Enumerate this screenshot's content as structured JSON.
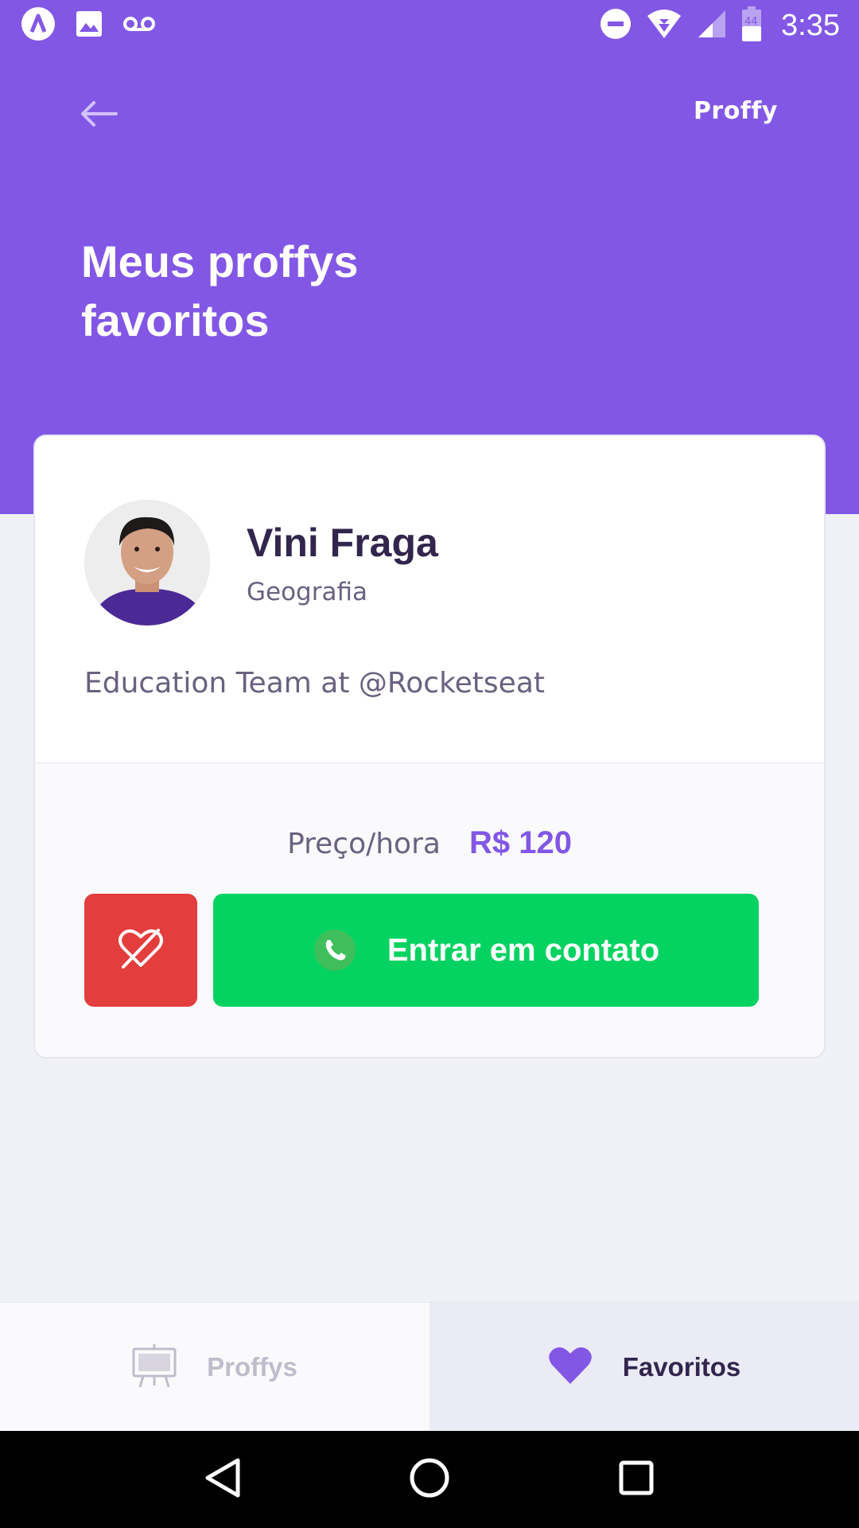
{
  "status_bar": {
    "time": "3:35",
    "battery_level": "44",
    "left_icons": [
      "app-notification-icon",
      "image-notification-icon",
      "voicemail-icon"
    ],
    "right_icons": [
      "do-not-disturb-icon",
      "wifi-icon",
      "signal-icon",
      "battery-icon"
    ]
  },
  "header": {
    "brand": "Proffy",
    "title": "Meus proffys favoritos",
    "back_icon": "arrow-left-icon"
  },
  "card": {
    "name": "Vini Fraga",
    "subject": "Geografia",
    "bio": "Education Team at @Rocketseat",
    "price_label": "Preço/hora",
    "price_value": "R$ 120",
    "unfavorite_icon": "heart-outline-icon",
    "contact_label": "Entrar em contato",
    "contact_icon": "whatsapp-icon"
  },
  "tabs": [
    {
      "label": "Proffys",
      "icon": "easel-icon",
      "active": false
    },
    {
      "label": "Favoritos",
      "icon": "heart-icon",
      "active": true
    }
  ],
  "colors": {
    "primary": "#8257E5",
    "background": "#F0F0F7",
    "title_text": "#32264D",
    "body_text": "#6A6180",
    "danger": "#E33D3D",
    "success": "#04D361",
    "inactive_tab": "#C1BCCC"
  }
}
